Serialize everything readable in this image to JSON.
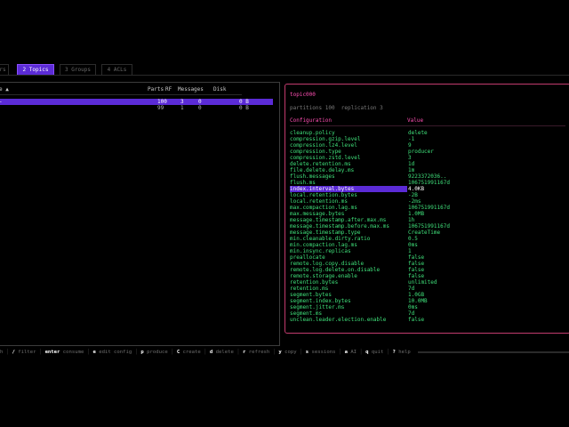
{
  "tabs": [
    {
      "label": "rs",
      "active": false
    },
    {
      "label": "2 Topics",
      "active": true
    },
    {
      "label": "3 Groups",
      "active": false
    },
    {
      "label": "4 ACLs",
      "active": false
    }
  ],
  "topics_table": {
    "headers": {
      "name": "e ▲",
      "parts": "Parts",
      "rf": "RF",
      "messages": "Messages",
      "disk": "Disk"
    },
    "rows": [
      {
        "name": "-",
        "parts": "100",
        "rf": "3",
        "messages": "0",
        "disk": "0 B",
        "selected": true
      },
      {
        "name": "",
        "parts": "99",
        "rf": "1",
        "messages": "0",
        "disk": "0 B",
        "selected": false
      }
    ]
  },
  "details": {
    "topic": "topic000",
    "summary": "partitions 100  replication 3",
    "columns": {
      "config": "Configuration",
      "value": "Value"
    },
    "selected_index": 9,
    "configs": [
      {
        "key": "cleanup.policy",
        "value": "delete"
      },
      {
        "key": "compression.gzip.level",
        "value": "-1"
      },
      {
        "key": "compression.lz4.level",
        "value": "9"
      },
      {
        "key": "compression.type",
        "value": "producer"
      },
      {
        "key": "compression.zstd.level",
        "value": "3"
      },
      {
        "key": "delete.retention.ms",
        "value": "1d"
      },
      {
        "key": "file.delete.delay.ms",
        "value": "1m"
      },
      {
        "key": "flush.messages",
        "value": "9223372036.."
      },
      {
        "key": "flush.ms",
        "value": "106751991167d"
      },
      {
        "key": "index.interval.bytes",
        "value": "4.0KB"
      },
      {
        "key": "local.retention.bytes",
        "value": "-2B"
      },
      {
        "key": "local.retention.ms",
        "value": "-2ms"
      },
      {
        "key": "max.compaction.lag.ms",
        "value": "106751991167d"
      },
      {
        "key": "max.message.bytes",
        "value": "1.0MB"
      },
      {
        "key": "message.timestamp.after.max.ms",
        "value": "1h"
      },
      {
        "key": "message.timestamp.before.max.ms",
        "value": "106751991167d"
      },
      {
        "key": "message.timestamp.type",
        "value": "CreateTime"
      },
      {
        "key": "min.cleanable.dirty.ratio",
        "value": "0.5"
      },
      {
        "key": "min.compaction.lag.ms",
        "value": "0ms"
      },
      {
        "key": "min.insync.replicas",
        "value": "1"
      },
      {
        "key": "preallocate",
        "value": "false"
      },
      {
        "key": "remote.log.copy.disable",
        "value": "false"
      },
      {
        "key": "remote.log.delete.on.disable",
        "value": "false"
      },
      {
        "key": "remote.storage.enable",
        "value": "false"
      },
      {
        "key": "retention.bytes",
        "value": "unlimited"
      },
      {
        "key": "retention.ms",
        "value": "7d"
      },
      {
        "key": "segment.bytes",
        "value": "1.0GB"
      },
      {
        "key": "segment.index.bytes",
        "value": "10.0MB"
      },
      {
        "key": "segment.jitter.ms",
        "value": "0ms"
      },
      {
        "key": "segment.ms",
        "value": "7d"
      },
      {
        "key": "unclean.leader.election.enable",
        "value": "false"
      }
    ]
  },
  "help_bar": [
    {
      "key": "",
      "desc": "h"
    },
    {
      "key": "/",
      "desc": "filter"
    },
    {
      "key": "enter",
      "desc": "consume"
    },
    {
      "key": "e",
      "desc": "edit config"
    },
    {
      "key": "p",
      "desc": "produce"
    },
    {
      "key": "C",
      "desc": "create"
    },
    {
      "key": "d",
      "desc": "delete"
    },
    {
      "key": "r",
      "desc": "refresh"
    },
    {
      "key": "y",
      "desc": "copy"
    },
    {
      "key": "s",
      "desc": "sessions"
    },
    {
      "key": "a",
      "desc": "AI"
    },
    {
      "key": "q",
      "desc": "quit"
    },
    {
      "key": "?",
      "desc": "help"
    }
  ]
}
